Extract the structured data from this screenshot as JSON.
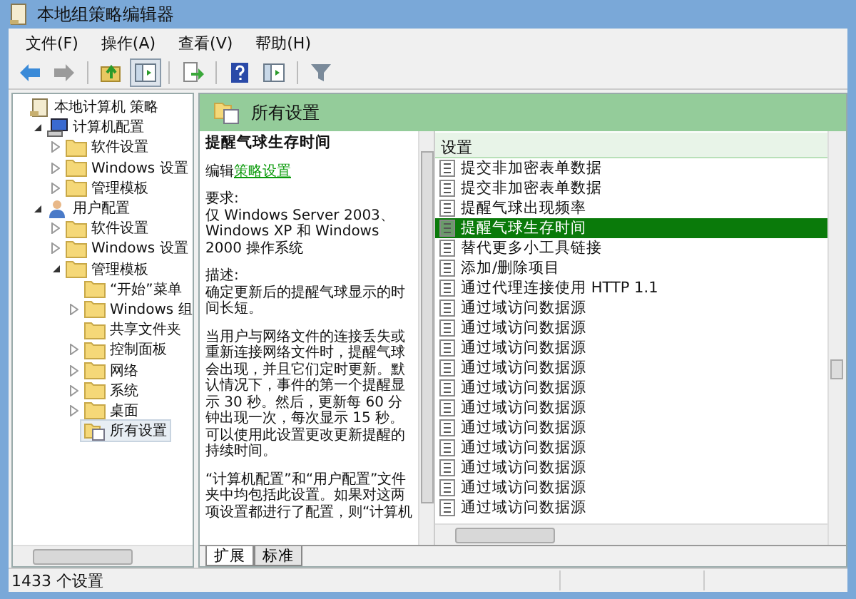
{
  "window": {
    "title": "本地组策略编辑器"
  },
  "menu": [
    "文件(F)",
    "操作(A)",
    "查看(V)",
    "帮助(H)"
  ],
  "toolbar": [
    {
      "kind": "back"
    },
    {
      "kind": "forward"
    },
    {
      "kind": "sep"
    },
    {
      "kind": "up"
    },
    {
      "kind": "pane",
      "selected": true
    },
    {
      "kind": "sep"
    },
    {
      "kind": "export"
    },
    {
      "kind": "sep"
    },
    {
      "kind": "help"
    },
    {
      "kind": "pane",
      "selected": false
    },
    {
      "kind": "sep"
    },
    {
      "kind": "filter"
    }
  ],
  "tree": [
    {
      "label": "本地计算机 策略",
      "kind": "policy",
      "selected": false,
      "children": [
        {
          "label": "计算机配置",
          "kind": "computer",
          "expanded": true,
          "selected": false,
          "children": [
            {
              "label": "软件设置",
              "kind": "folder",
              "expanded": false,
              "selected": false
            },
            {
              "label": "Windows 设置",
              "kind": "folder",
              "expanded": false,
              "selected": false
            },
            {
              "label": "管理模板",
              "kind": "folder",
              "expanded": false,
              "selected": false
            }
          ]
        },
        {
          "label": "用户配置",
          "kind": "user",
          "expanded": true,
          "selected": false,
          "children": [
            {
              "label": "软件设置",
              "kind": "folder",
              "expanded": false,
              "selected": false
            },
            {
              "label": "Windows 设置",
              "kind": "folder",
              "expanded": false,
              "selected": false
            },
            {
              "label": "管理模板",
              "kind": "folder",
              "expanded": true,
              "selected": false,
              "children": [
                {
                  "label": "“开始”菜单",
                  "kind": "folder",
                  "selected": false
                },
                {
                  "label": "Windows 组",
                  "kind": "folder",
                  "expanded": false,
                  "selected": false
                },
                {
                  "label": "共享文件夹",
                  "kind": "folder",
                  "selected": false
                },
                {
                  "label": "控制面板",
                  "kind": "folder",
                  "expanded": false,
                  "selected": false
                },
                {
                  "label": "网络",
                  "kind": "folder",
                  "expanded": false,
                  "selected": false
                },
                {
                  "label": "系统",
                  "kind": "folder",
                  "expanded": false,
                  "selected": false
                },
                {
                  "label": "桌面",
                  "kind": "folder",
                  "expanded": false,
                  "selected": false
                },
                {
                  "label": "所有设置",
                  "kind": "settings",
                  "selected": true
                }
              ]
            }
          ]
        }
      ]
    }
  ],
  "header": {
    "title": "所有设置"
  },
  "description": {
    "title": "提醒气球生存时间",
    "edit_prefix": "编辑",
    "edit_link": "策略设置",
    "paragraphs": [
      {
        "label": "要求:",
        "text": "仅 Windows Server 2003、Windows XP 和 Windows 2000 操作系统"
      },
      {
        "label": "描述:",
        "text": "确定更新后的提醒气球显示的时间长短。"
      },
      {
        "text": "当用户与网络文件的连接丢失或重新连接网络文件时，提醒气球会出现，并且它们定时更新。默认情况下，事件的第一个提醒显示 30 秒。然后，更新每 60 分钟出现一次，每次显示 15 秒。可以使用此设置更改更新提醒的持续时间。"
      },
      {
        "text": "“计算机配置”和“用户配置”文件夹中均包括此设置。如果对这两项设置都进行了配置，则“计算机"
      }
    ]
  },
  "list": {
    "column": "设置",
    "rows": [
      {
        "label": "提交非加密表单数据",
        "selected": false
      },
      {
        "label": "提交非加密表单数据",
        "selected": false
      },
      {
        "label": "提醒气球出现频率",
        "selected": false
      },
      {
        "label": "提醒气球生存时间",
        "selected": true
      },
      {
        "label": "替代更多小工具链接",
        "selected": false
      },
      {
        "label": "添加/删除项目",
        "selected": false
      },
      {
        "label": "通过代理连接使用 HTTP 1.1",
        "selected": false
      },
      {
        "label": "通过域访问数据源",
        "selected": false
      },
      {
        "label": "通过域访问数据源",
        "selected": false
      },
      {
        "label": "通过域访问数据源",
        "selected": false
      },
      {
        "label": "通过域访问数据源",
        "selected": false
      },
      {
        "label": "通过域访问数据源",
        "selected": false
      },
      {
        "label": "通过域访问数据源",
        "selected": false
      },
      {
        "label": "通过域访问数据源",
        "selected": false
      },
      {
        "label": "通过域访问数据源",
        "selected": false
      },
      {
        "label": "通过域访问数据源",
        "selected": false
      },
      {
        "label": "通过域访问数据源",
        "selected": false
      },
      {
        "label": "通过域访问数据源",
        "selected": false
      }
    ]
  },
  "tabs": [
    {
      "label": "扩展",
      "selected": true
    },
    {
      "label": "标准",
      "selected": false
    }
  ],
  "status_bar": "1433 个设置"
}
